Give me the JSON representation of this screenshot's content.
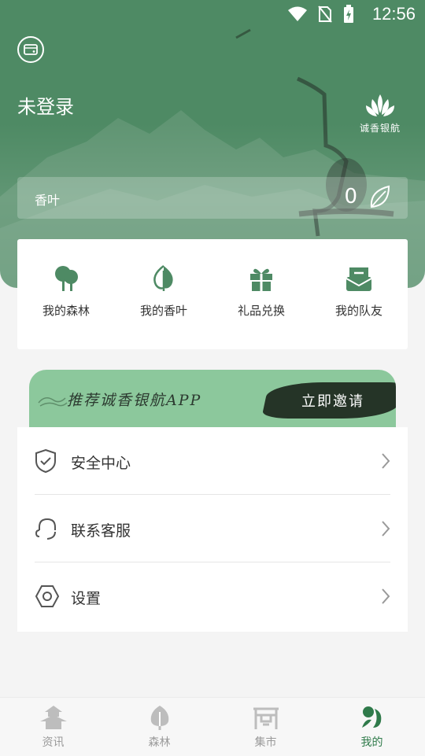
{
  "status_bar": {
    "time": "12:56"
  },
  "header": {
    "login_status": "未登录",
    "logo_text": "诚香银航",
    "leaf_label": "香叶",
    "leaf_count": "0"
  },
  "quick_actions": [
    {
      "label": "我的森林",
      "icon": "tree-icon"
    },
    {
      "label": "我的香叶",
      "icon": "leaf-icon"
    },
    {
      "label": "礼品兑换",
      "icon": "gift-icon"
    },
    {
      "label": "我的队友",
      "icon": "message-icon"
    }
  ],
  "banner": {
    "title": "推荐诚香银航APP",
    "action": "立即邀请"
  },
  "menu": [
    {
      "label": "安全中心",
      "icon": "shield-icon"
    },
    {
      "label": "联系客服",
      "icon": "headset-icon"
    },
    {
      "label": "设置",
      "icon": "gear-icon"
    }
  ],
  "tabbar": [
    {
      "label": "资讯",
      "icon": "pagoda-icon"
    },
    {
      "label": "森林",
      "icon": "tree-icon"
    },
    {
      "label": "集市",
      "icon": "market-icon"
    },
    {
      "label": "我的",
      "icon": "profile-icon",
      "active": true
    }
  ],
  "colors": {
    "brand_green": "#4e8a64",
    "active_tab": "#2f7a4a"
  }
}
